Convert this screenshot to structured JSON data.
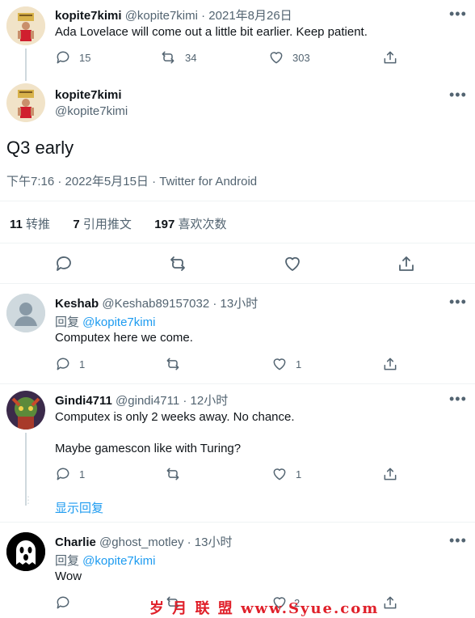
{
  "tweet1": {
    "name": "kopite7kimi",
    "handle_time": "@kopite7kimi · 2021年8月26日",
    "text": "Ada Lovelace will come out a little bit earlier. Keep patient.",
    "replies": "15",
    "retweets": "34",
    "likes": "303"
  },
  "main": {
    "name": "kopite7kimi",
    "handle": "@kopite7kimi",
    "text": "Q3 early",
    "meta": "下午7:16 · 2022年5月15日 · Twitter for Android",
    "retweet_count": "11",
    "retweet_label": "转推",
    "quote_count": "7",
    "quote_label": "引用推文",
    "like_count": "197",
    "like_label": "喜欢次数"
  },
  "replies": [
    {
      "name": "Keshab",
      "handle_time": "@Keshab89157032 · 13小时",
      "reply_prefix": "回复 ",
      "reply_to": "@kopite7kimi",
      "text": "Computex here we come.",
      "replies": "1",
      "likes": "1"
    },
    {
      "name": "Gindi4711",
      "handle_time": "@gindi4711 · 12小时",
      "text": "Computex is only 2 weeks away. No chance.",
      "text2": "Maybe gamescon like with Turing?",
      "replies": "1",
      "likes": "1",
      "show_replies": "显示回复"
    },
    {
      "name": "Charlie",
      "handle_time": "@ghost_motley · 13小时",
      "reply_prefix": "回复 ",
      "reply_to": "@kopite7kimi",
      "text": "Wow",
      "likes": "2"
    }
  ],
  "more_label": "•••",
  "watermark": "岁 月 联 盟   www.Syue.com",
  "colors": {
    "link": "#1d9bf0",
    "secondary": "#536471",
    "divider": "#eff3f4"
  }
}
